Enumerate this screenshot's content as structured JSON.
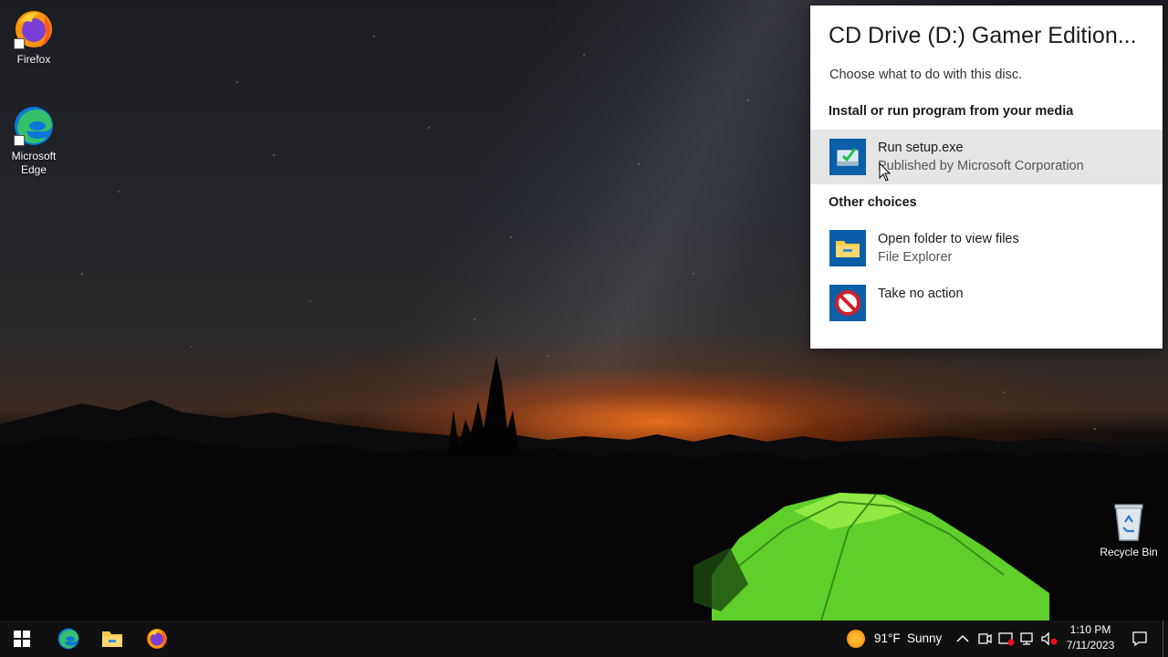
{
  "desktop": {
    "icons": [
      {
        "label": "Firefox",
        "icon": "firefox-icon"
      },
      {
        "label": "Microsoft Edge",
        "icon": "edge-icon"
      },
      {
        "label": "Recycle Bin",
        "icon": "recycle-bin-icon"
      }
    ]
  },
  "autoplay": {
    "title": "CD Drive (D:) Gamer Edition...",
    "subtitle": "Choose what to do with this disc.",
    "install_heading": "Install or run program from your media",
    "other_heading": "Other choices",
    "choices": [
      {
        "title": "Run setup.exe",
        "detail": "Published by Microsoft Corporation",
        "icon": "setup-install-icon"
      },
      {
        "title": "Open folder to view files",
        "detail": "File Explorer",
        "icon": "file-explorer-icon"
      },
      {
        "title": "Take no action",
        "icon": "no-action-icon"
      }
    ]
  },
  "taskbar": {
    "pinned": [
      "start-icon",
      "edge-icon",
      "file-explorer-icon",
      "firefox-icon"
    ],
    "weather": {
      "temp": "91°F",
      "condition": "Sunny",
      "icon": "sun-icon"
    },
    "tray_icons": [
      "chevron-up-icon",
      "meet-now-icon",
      "security-icon",
      "network-icon",
      "volume-muted-icon"
    ],
    "clock": {
      "time": "1:10 PM",
      "date": "7/11/2023"
    },
    "notification_icon": "notification-icon"
  },
  "colors": {
    "taskbar_bg": "#101010",
    "panel_bg": "#ffffff",
    "highlight": "#e5e5e5",
    "icon_tile_blue": "#0a5fa8"
  }
}
